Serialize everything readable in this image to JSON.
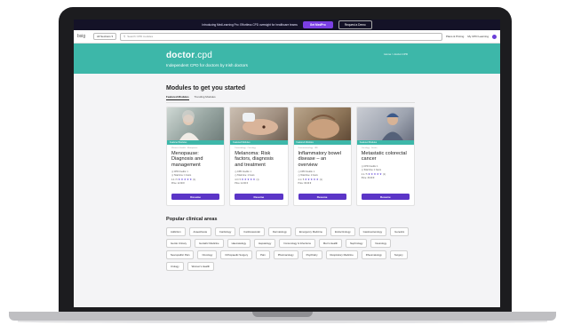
{
  "announcement": {
    "text": "Introducing MedLearning Pro: Effortless CPD oversight for healthcare teams",
    "cta": "Get MedPro",
    "secondary": "Request a Demo"
  },
  "nav": {
    "brand": "bsig",
    "scope": "All Sections",
    "search_placeholder": "Search CPD modules",
    "pricing": "Plans & Pricing",
    "my_cpd": "My CPD Learning"
  },
  "hero": {
    "logo_bold": "doctor",
    "logo_rest": ".cpd",
    "tagline": "Independent CPD for doctors by Irish doctors",
    "breadcrumb": "Home > doctor.CPD"
  },
  "modules": {
    "heading": "Modules to get you started",
    "tabs": [
      {
        "label": "Featured Modules",
        "active": true
      },
      {
        "label": "Trending Modules",
        "active": false
      }
    ],
    "cards": [
      {
        "category": "Featured Modules",
        "meta": "Women's Health · Menopause",
        "title": "Menopause: Diagnosis and management",
        "credits": "CPD Credits: 1",
        "time": "Total time: 1 hours",
        "rating": "4.4 / 5",
        "stars": "★★★★★",
        "reviews": "(1)",
        "price": "Price: 12.00 €",
        "button": "Resume"
      },
      {
        "category": "Featured Modules",
        "meta": "Dermatology · Oncology",
        "title": "Melanoma: Risk factors, diagnosis and treatment",
        "credits": "CPD Credits: 1",
        "time": "Total time: 1 hours",
        "rating": "4.3 / 5",
        "stars": "★★★★★",
        "reviews": "(1)",
        "price": "Price: 12.00 €",
        "button": "Resume"
      },
      {
        "category": "Featured Modules",
        "meta": "Gastroenterology · IBD",
        "title": "Inflammatory bowel disease – an overview",
        "credits": "CPD Credits: 1",
        "time": "Total time: 1 hours",
        "rating": "4.1 / 5",
        "stars": "★★★★★",
        "reviews": "(1)",
        "price": "Price: 30.00 €",
        "button": "Resume"
      },
      {
        "category": "Featured Modules",
        "meta": "Oncology · Gastro",
        "title": "Metastatic colorectal cancer",
        "credits": "CPD Credits: 1",
        "time": "Total time: 1 hours",
        "rating": "4.1 / 5",
        "stars": "★★★★★",
        "reviews": "(1)",
        "price": "Price: 30.00 €",
        "button": "Resume"
      }
    ]
  },
  "areas": {
    "heading": "Popular clinical areas",
    "items": [
      "Addiction",
      "Anaesthesia",
      "Cardiology",
      "Cardiovascular",
      "Dermatology",
      "Emergency Medicine",
      "Endocrinology",
      "Gastroenterology",
      "Genetics",
      "Genito Urinary",
      "Geriatric Medicine",
      "Haematology",
      "Hepatology",
      "Immunology & Infections",
      "Men's Health",
      "Nephrology",
      "Neurology",
      "Neuropathic Pain",
      "Oncology",
      "Orthopaedic Surgery",
      "Pain",
      "Pharmacology",
      "Psychiatry",
      "Respiratory Medicine",
      "Rheumatology",
      "Surgery",
      "Urology",
      "Women's Health"
    ]
  },
  "colors": {
    "teal": "#3db7a9",
    "purple": "#5b35c7",
    "dark": "#141227"
  }
}
